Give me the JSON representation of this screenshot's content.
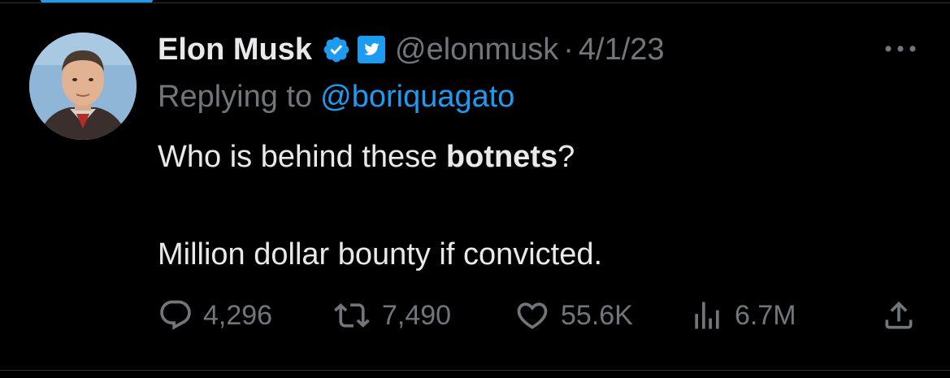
{
  "author": {
    "display_name": "Elon Musk",
    "handle": "@elonmusk",
    "separator": "·",
    "date": "4/1/23"
  },
  "reply": {
    "prefix": "Replying to",
    "mention": "@boriquagato"
  },
  "tweet": {
    "line1_before": "Who is behind these ",
    "line1_bold": "botnets",
    "line1_after": "?",
    "line2": "Million dollar bounty if convicted."
  },
  "actions": {
    "replies": "4,296",
    "retweets": "7,490",
    "likes": "55.6K",
    "views": "6.7M"
  },
  "icons": {
    "verified": "verified-badge-icon",
    "affiliate": "twitter-bird-icon",
    "more": "more-dots-icon",
    "reply": "reply-bubble-icon",
    "retweet": "retweet-icon",
    "like": "heart-icon",
    "views": "analytics-bars-icon",
    "share": "share-icon"
  },
  "colors": {
    "background": "#000000",
    "text_primary": "#e7e9ea",
    "text_secondary": "#71767b",
    "accent": "#1d9bf0",
    "border": "#2f3336"
  }
}
